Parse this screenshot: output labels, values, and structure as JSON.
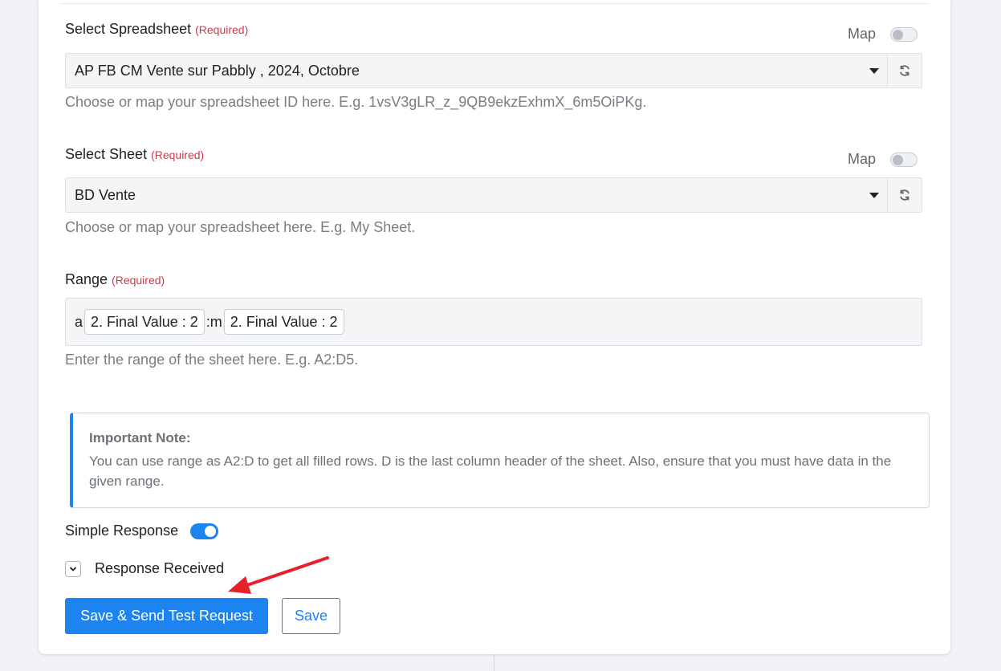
{
  "spreadsheet": {
    "label": "Select Spreadsheet",
    "required": "(Required)",
    "map_label": "Map",
    "value": "AP FB CM Vente sur Pabbly , 2024, Octobre",
    "help": "Choose or map your spreadsheet ID here. E.g. 1vsV3gLR_z_9QB9ekzExhmX_6m5OiPKg."
  },
  "sheet": {
    "label": "Select Sheet",
    "required": "(Required)",
    "map_label": "Map",
    "value": "BD Vente",
    "help": "Choose or map your spreadsheet here. E.g. My Sheet."
  },
  "range": {
    "label": "Range",
    "required": "(Required)",
    "prefix": "a",
    "chip1": "2. Final Value : 2",
    "separator": ":m",
    "chip2": "2. Final Value : 2",
    "help": "Enter the range of the sheet here. E.g. A2:D5."
  },
  "note": {
    "title": "Important Note:",
    "body": "You can use range as A2:D to get all filled rows. D is the last column header of the sheet. Also, ensure that you must have data in the given range."
  },
  "simple_response": {
    "label": "Simple Response",
    "enabled": true
  },
  "response_received": {
    "label": "Response Received"
  },
  "buttons": {
    "save_send": "Save & Send Test Request",
    "save": "Save"
  },
  "colors": {
    "primary": "#1b84f1",
    "required": "#d0384a",
    "annotation_arrow": "#e8202a"
  }
}
